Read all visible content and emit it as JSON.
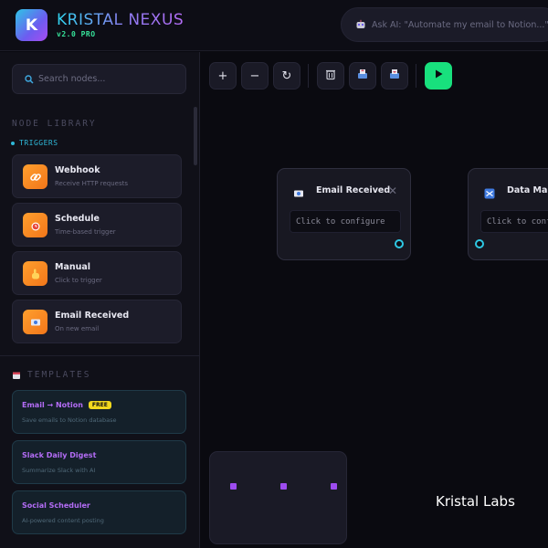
{
  "header": {
    "logo_letter": "K",
    "brand": "KRISTAL NEXUS",
    "version": "v2.0 PRO",
    "ask_placeholder": "Ask AI: \"Automate my email to Notion...\""
  },
  "sidebar": {
    "search_placeholder": "Search nodes...",
    "library_title": "NODE LIBRARY",
    "triggers_label": "TRIGGERS",
    "nodes": [
      {
        "title": "Webhook",
        "subtitle": "Receive HTTP requests",
        "icon": "link-icon"
      },
      {
        "title": "Schedule",
        "subtitle": "Time-based trigger",
        "icon": "alarm-clock-icon"
      },
      {
        "title": "Manual",
        "subtitle": "Click to trigger",
        "icon": "pointing-hand-icon"
      },
      {
        "title": "Email Received",
        "subtitle": "On new email",
        "icon": "email-icon"
      }
    ],
    "templates_title": "TEMPLATES",
    "templates": [
      {
        "name": "Email → Notion",
        "badge": "FREE",
        "desc": "Save emails to Notion database"
      },
      {
        "name": "Slack Daily Digest",
        "badge": "",
        "desc": "Summarize Slack with AI"
      },
      {
        "name": "Social Scheduler",
        "badge": "",
        "desc": "AI-powered content posting"
      }
    ]
  },
  "toolbar": {
    "zoom_in": "+",
    "zoom_out": "−",
    "reset": "↻"
  },
  "canvas": {
    "nodes": [
      {
        "title": "Email Received",
        "placeholder": "Click to configure"
      },
      {
        "title": "Data Mapper",
        "placeholder": "Click to configure"
      }
    ]
  },
  "watermark": "Kristal Labs",
  "colors": {
    "accent_cyan": "#2fc8e4",
    "accent_purple": "#b36cf5",
    "run_green": "#18e07d",
    "trigger_orange": "#f58a22",
    "badge_yellow": "#f2d91e"
  }
}
